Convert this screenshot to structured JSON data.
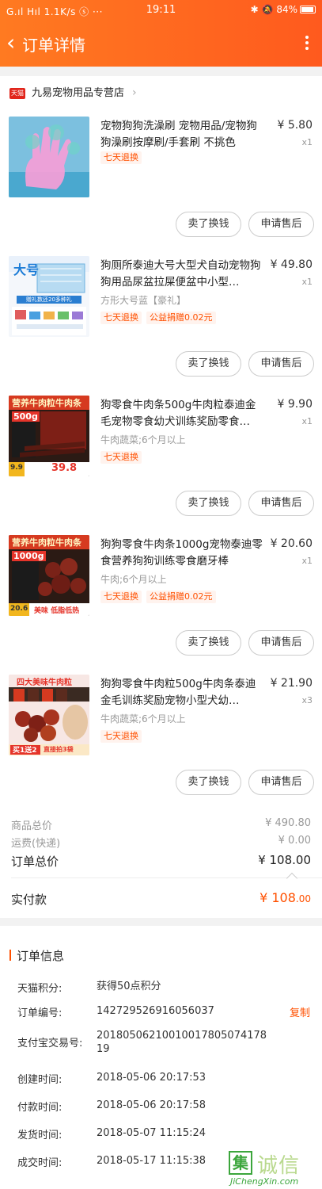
{
  "status_bar": {
    "left": "G.ıl Hıl 1.1K/s ⓢ ···",
    "time": "19:11",
    "battery": "84%"
  },
  "nav": {
    "title": "订单详情"
  },
  "shop": {
    "badge": "天猫",
    "name": "九易宠物用品专营店"
  },
  "items": [
    {
      "title": "宠物狗狗洗澡刷 宠物用品/宠物狗狗澡刷按摩刷/手套刷 不挑色",
      "price": "¥ 5.80",
      "qty": "x1",
      "sku": "",
      "tags": [
        "七天退换"
      ],
      "img_label": "",
      "img_sub": "",
      "thumb_icon": "glove-brush-image"
    },
    {
      "title": "狗厕所泰迪大号大型犬自动宠物狗狗用品尿盆拉屎便盆中小型…",
      "price": "¥ 49.80",
      "qty": "x1",
      "sku": "方形大号蓝【豪礼】",
      "tags": [
        "七天退换",
        "公益捐赠0.02元"
      ],
      "img_label": "大号",
      "img_sub": "赠礼数还20多种礼",
      "thumb_icon": "dog-toilet-image"
    },
    {
      "title": "狗零食牛肉条500g牛肉粒泰迪金毛宠物零食幼犬训练奖励零食…",
      "price": "¥ 9.90",
      "qty": "x1",
      "sku": "牛肉蔬菜;6个月以上",
      "tags": [
        "七天退换"
      ],
      "img_label": "营养牛肉粒牛肉条",
      "img_sub": "500g",
      "img_price": "39.8",
      "img_small": "9.9",
      "thumb_icon": "beef-snack-image"
    },
    {
      "title": "狗狗零食牛肉条1000g宠物泰迪零食营养狗狗训练零食磨牙棒",
      "price": "¥ 20.60",
      "qty": "x1",
      "sku": "牛肉;6个月以上",
      "tags": [
        "七天退换",
        "公益捐赠0.02元"
      ],
      "img_label": "营养牛肉粒牛肉条",
      "img_sub": "1000g",
      "img_price": "美味 低脂低热",
      "img_small": "20.6",
      "thumb_icon": "beef-snack-image"
    },
    {
      "title": "狗狗零食牛肉粒500g牛肉条泰迪金毛训练奖励宠物小型犬幼…",
      "price": "¥ 21.90",
      "qty": "x3",
      "sku": "牛肉蔬菜;6个月以上",
      "tags": [
        "七天退换"
      ],
      "img_label": "四大美味牛肉粒",
      "img_sub": "买1送2",
      "img_price": "直接拍3袋",
      "thumb_icon": "beef-cubes-image"
    }
  ],
  "actions": {
    "sell": "卖了换钱",
    "after_sale": "申请售后"
  },
  "totals": {
    "goods_label": "商品总价",
    "goods_value": "¥ 490.80",
    "shipping_label": "运费(快递)",
    "shipping_value": "¥ 0.00",
    "order_label": "订单总价",
    "order_value": "¥ 108.00",
    "paid_label": "实付款",
    "paid_int": "¥ 108",
    "paid_dec": ".00"
  },
  "order_info": {
    "title": "订单信息",
    "rows": [
      {
        "key": "天猫积分:",
        "value": "获得50点积分"
      },
      {
        "key": "订单编号:",
        "value": "142729526916056037",
        "action": "复制"
      },
      {
        "key": "支付宝交易号:",
        "value": "2018050621001001780507417819"
      },
      {
        "key": "创建时间:",
        "value": "2018-05-06 20:17:53"
      },
      {
        "key": "付款时间:",
        "value": "2018-05-06 20:17:58"
      },
      {
        "key": "发货时间:",
        "value": "2018-05-07 11:15:24"
      },
      {
        "key": "成交时间:",
        "value": "2018-05-17 11:15:38"
      }
    ]
  },
  "watermark": {
    "mark": "集",
    "main": "诚信",
    "site": "JiChengXin.com"
  },
  "colors": {
    "accent": "#ff5000",
    "header_from": "#ff7a21",
    "header_to": "#ff5a1e"
  }
}
